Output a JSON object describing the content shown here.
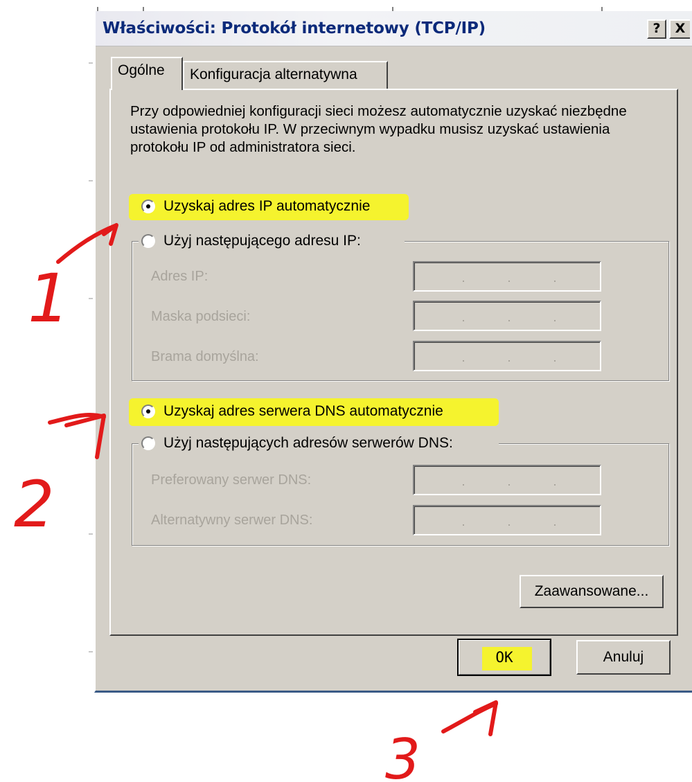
{
  "window": {
    "title": "Właściwości: Protokół internetowy (TCP/IP)",
    "help_button": "?",
    "close_button": "X"
  },
  "tabs": [
    {
      "label": "Ogólne",
      "selected": true
    },
    {
      "label": "Konfiguracja alternatywna",
      "selected": false
    }
  ],
  "intro_text": "Przy odpowiedniej konfiguracji sieci możesz automatycznie uzyskać niezbędne ustawienia protokołu IP. W przeciwnym wypadku musisz uzyskać ustawienia protokołu IP od administratora sieci.",
  "ip": {
    "auto_option": {
      "label": "Uzyskaj adres IP automatycznie",
      "checked": true
    },
    "manual_option": {
      "label": "Użyj następującego adresu IP:",
      "checked": false
    },
    "fields": [
      {
        "label": "Adres IP:",
        "value": "   .   .   ."
      },
      {
        "label": "Maska podsieci:",
        "value": "   .   .   ."
      },
      {
        "label": "Brama domyślna:",
        "value": "   .   .   ."
      }
    ]
  },
  "dns": {
    "auto_option": {
      "label": "Uzyskaj adres serwera DNS automatycznie",
      "checked": true
    },
    "manual_option": {
      "label": "Użyj następujących adresów serwerów DNS:",
      "checked": false
    },
    "fields": [
      {
        "label": "Preferowany serwer DNS:",
        "value": "   .   .   ."
      },
      {
        "label": "Alternatywny serwer DNS:",
        "value": "   .   .   ."
      }
    ]
  },
  "buttons": {
    "advanced": "Zaawansowane...",
    "ok": "OK",
    "cancel": "Anuluj"
  },
  "annotations": {
    "step1": "1",
    "step2": "2",
    "step3": "3",
    "color": "#e21a1a",
    "highlight_color": "#f5f32e"
  }
}
